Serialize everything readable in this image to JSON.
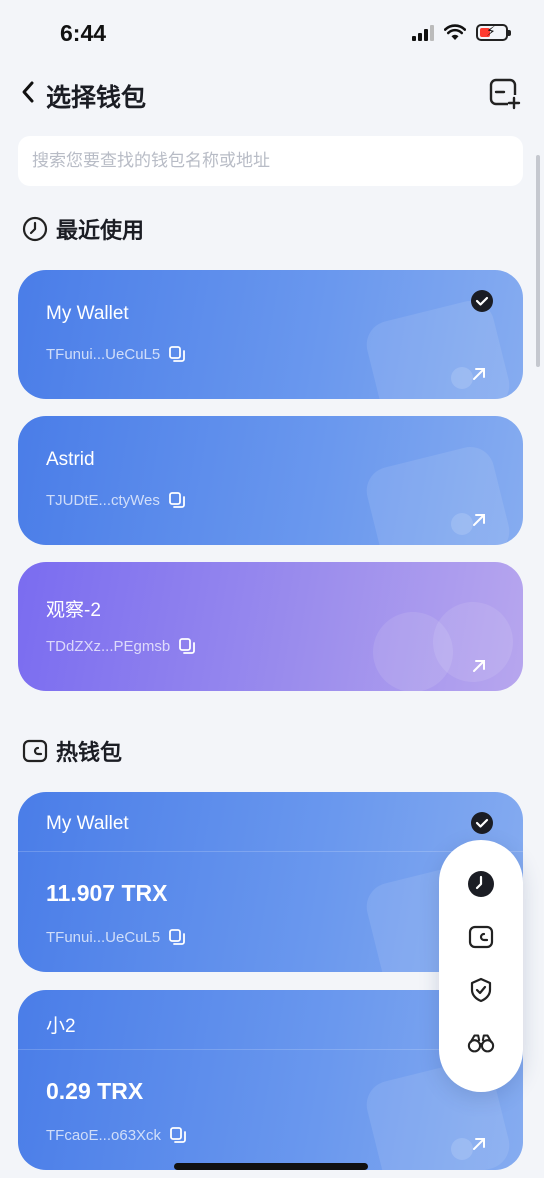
{
  "status_bar": {
    "time": "6:44"
  },
  "nav": {
    "title": "选择钱包"
  },
  "search": {
    "placeholder": "搜索您要查找的钱包名称或地址"
  },
  "sections": {
    "recent": "最近使用",
    "hot": "热钱包"
  },
  "recent_wallets": [
    {
      "name": "My Wallet",
      "address": "TFunui...UeCuL5",
      "selected": true
    },
    {
      "name": "Astrid",
      "address": "TJUDtE...ctyWes",
      "selected": false
    },
    {
      "name": "观察-2",
      "address": "TDdZXz...PEgmsb",
      "selected": false,
      "type": "watch"
    }
  ],
  "hot_wallets": [
    {
      "name": "My Wallet",
      "balance": "11.907 TRX",
      "address": "TFunui...UeCuL5",
      "selected": true
    },
    {
      "name": "小2",
      "balance": "0.29 TRX",
      "address": "TFcaoE...o63Xck",
      "selected": false
    }
  ],
  "side_nav": [
    "clock-icon",
    "wallet-icon",
    "shield-icon",
    "binoculars-icon"
  ],
  "colors": {
    "card_blue": "#4a7de8",
    "card_purple": "#7a6cf0",
    "background": "#f3f5f9"
  }
}
